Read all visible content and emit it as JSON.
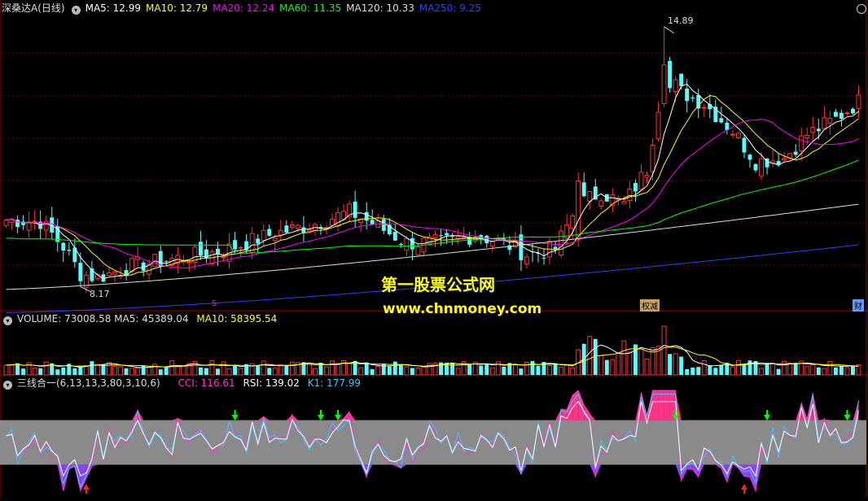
{
  "main": {
    "stock": "深桑达A",
    "period": "(日线)",
    "ma": [
      {
        "label": "MA5",
        "value": "12.99",
        "color": "#ffffff"
      },
      {
        "label": "MA10",
        "value": "12.79",
        "color": "#ffff00"
      },
      {
        "label": "MA20",
        "value": "12.24",
        "color": "#ff00ff"
      },
      {
        "label": "MA60",
        "value": "11.35",
        "color": "#00ff00"
      },
      {
        "label": "MA120",
        "value": "10.33",
        "color": "#dddddd"
      },
      {
        "label": "MA250",
        "value": "9.25",
        "color": "#2244ff"
      }
    ],
    "high_label": "14.89",
    "low_label": "8.17",
    "markers": [
      "S",
      "权减",
      "财"
    ]
  },
  "watermark": {
    "line1": "第一股票公式网",
    "line2": "www.chnmoney.com"
  },
  "volume": {
    "header_label": "VOLUME",
    "value": "73008.58",
    "ma5_label": "MA5",
    "ma5": "45389.04",
    "ma10_label": "MA10",
    "ma10": "58395.54"
  },
  "indicator": {
    "name": "三线合一(6,13,13,3,80,3,10,6)",
    "cci_label": "CCI",
    "cci": "116.61",
    "rsi_label": "RSI",
    "rsi": "139.02",
    "k1_label": "K1",
    "k1": "177.99"
  },
  "chart_data": {
    "type": "candlestick",
    "bars": 150,
    "price_range": [
      7.8,
      15.2
    ],
    "price_high": 14.89,
    "price_low": 8.17,
    "closes_keypoints": [
      [
        0,
        9.9
      ],
      [
        6,
        9.85
      ],
      [
        10,
        9.2
      ],
      [
        13,
        8.5
      ],
      [
        16,
        8.4
      ],
      [
        22,
        8.7
      ],
      [
        30,
        8.9
      ],
      [
        38,
        9.1
      ],
      [
        46,
        9.5
      ],
      [
        54,
        9.8
      ],
      [
        60,
        10.1
      ],
      [
        64,
        9.8
      ],
      [
        70,
        9.3
      ],
      [
        76,
        9.3
      ],
      [
        82,
        9.5
      ],
      [
        87,
        9.3
      ],
      [
        91,
        9.0
      ],
      [
        96,
        9.15
      ],
      [
        100,
        10.3
      ],
      [
        104,
        10.6
      ],
      [
        108,
        10.3
      ],
      [
        112,
        11.2
      ],
      [
        115,
        13.7
      ],
      [
        118,
        13.2
      ],
      [
        122,
        12.9
      ],
      [
        127,
        12.2
      ],
      [
        131,
        11.4
      ],
      [
        136,
        11.5
      ],
      [
        140,
        12.1
      ],
      [
        145,
        12.5
      ],
      [
        149,
        12.95
      ]
    ],
    "ma_series": [
      "MA5",
      "MA10",
      "MA20",
      "MA60",
      "MA120",
      "MA250"
    ],
    "ma250_endpoints": [
      7.5,
      9.25
    ],
    "volume_range": [
      0,
      140000
    ],
    "indicator_band": [
      20,
      80
    ]
  }
}
